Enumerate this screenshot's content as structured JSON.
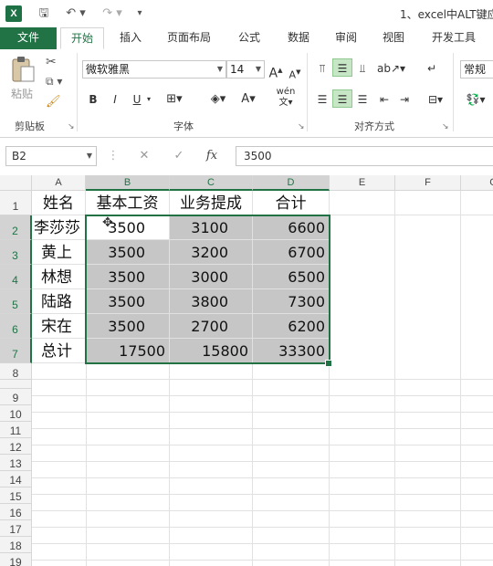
{
  "titlebar": {
    "app_icon": "X",
    "title": "1、excel中ALT键应",
    "icons": [
      "save-icon",
      "undo-icon",
      "redo-icon",
      "customize-icon"
    ]
  },
  "tabs": [
    "文件",
    "开始",
    "插入",
    "页面布局",
    "公式",
    "数据",
    "审阅",
    "视图",
    "开发工具"
  ],
  "ribbon": {
    "clipboard": {
      "paste": "粘贴",
      "group": "剪贴板"
    },
    "font": {
      "name": "微软雅黑",
      "size": "14",
      "grow": "A",
      "shrink": "A",
      "bold": "B",
      "italic": "I",
      "underline": "U",
      "font_color": "A",
      "wen": "wén",
      "group": "字体"
    },
    "alignment": {
      "group": "对齐方式"
    },
    "number": {
      "format": "常规"
    }
  },
  "formula_bar": {
    "name_box": "B2",
    "cancel": "✕",
    "enter": "✓",
    "fx": "fx",
    "value": "3500"
  },
  "sheet": {
    "columns": [
      "A",
      "B",
      "C",
      "D",
      "E",
      "F",
      "G"
    ],
    "rows": [
      "1",
      "2",
      "3",
      "4",
      "5",
      "6",
      "7",
      "8",
      "9",
      "10",
      "11",
      "12",
      "13",
      "14",
      "15",
      "16",
      "17",
      "18",
      "19"
    ],
    "headers": [
      "姓名",
      "基本工资",
      "业务提成",
      "合计"
    ],
    "data": [
      [
        "李莎莎",
        "3500",
        "3100",
        "6600"
      ],
      [
        "黄上",
        "3500",
        "3200",
        "6700"
      ],
      [
        "林想",
        "3500",
        "3000",
        "6500"
      ],
      [
        "陆路",
        "3500",
        "3800",
        "7300"
      ],
      [
        "宋在",
        "3500",
        "2700",
        "6200"
      ],
      [
        "总计",
        "17500",
        "15800",
        "33300"
      ]
    ],
    "selected_range": "B2:D7",
    "active_cell": "B2"
  }
}
